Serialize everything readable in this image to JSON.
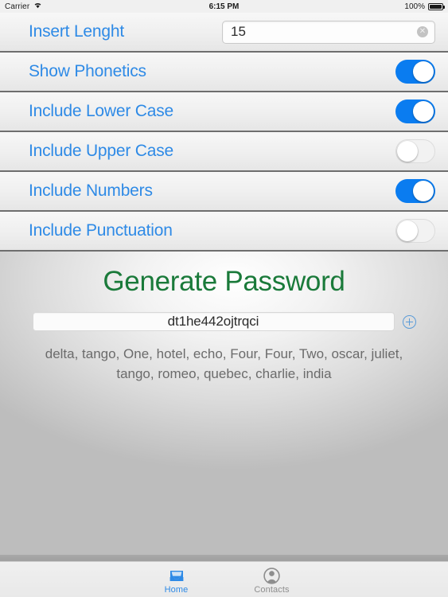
{
  "status_bar": {
    "carrier": "Carrier",
    "wifi_icon": "wifi-icon",
    "time": "6:15 PM",
    "battery_percent": "100%",
    "battery_icon": "battery-full-icon"
  },
  "settings": {
    "length_row": {
      "label": "Insert Lenght",
      "value": "15",
      "placeholder": "",
      "clear_icon": "✕"
    },
    "toggle_rows": [
      {
        "label": "Show Phonetics",
        "state": "on"
      },
      {
        "label": "Include Lower Case",
        "state": "on"
      },
      {
        "label": "Include Upper Case",
        "state": "off"
      },
      {
        "label": "Include Numbers",
        "state": "on"
      },
      {
        "label": "Include Punctuation",
        "state": "off"
      }
    ]
  },
  "main": {
    "title": "Generate Password",
    "password": "dt1he442ojtrqci",
    "add_icon": "plus-circle-icon",
    "phonetics": "delta, tango, One, hotel, echo, Four, Four, Two, oscar, juliet, tango, romeo, quebec, charlie, india"
  },
  "tab_bar": {
    "tabs": [
      {
        "label": "Home",
        "icon": "inbox-tray-icon",
        "active": true
      },
      {
        "label": "Contacts",
        "icon": "person-icon",
        "active": false
      }
    ]
  },
  "colors": {
    "accent_blue": "#2e8ae6",
    "switch_on": "#0a7cf0",
    "title_green": "#1a7a3a",
    "inactive_gray": "#8e8e8e"
  }
}
